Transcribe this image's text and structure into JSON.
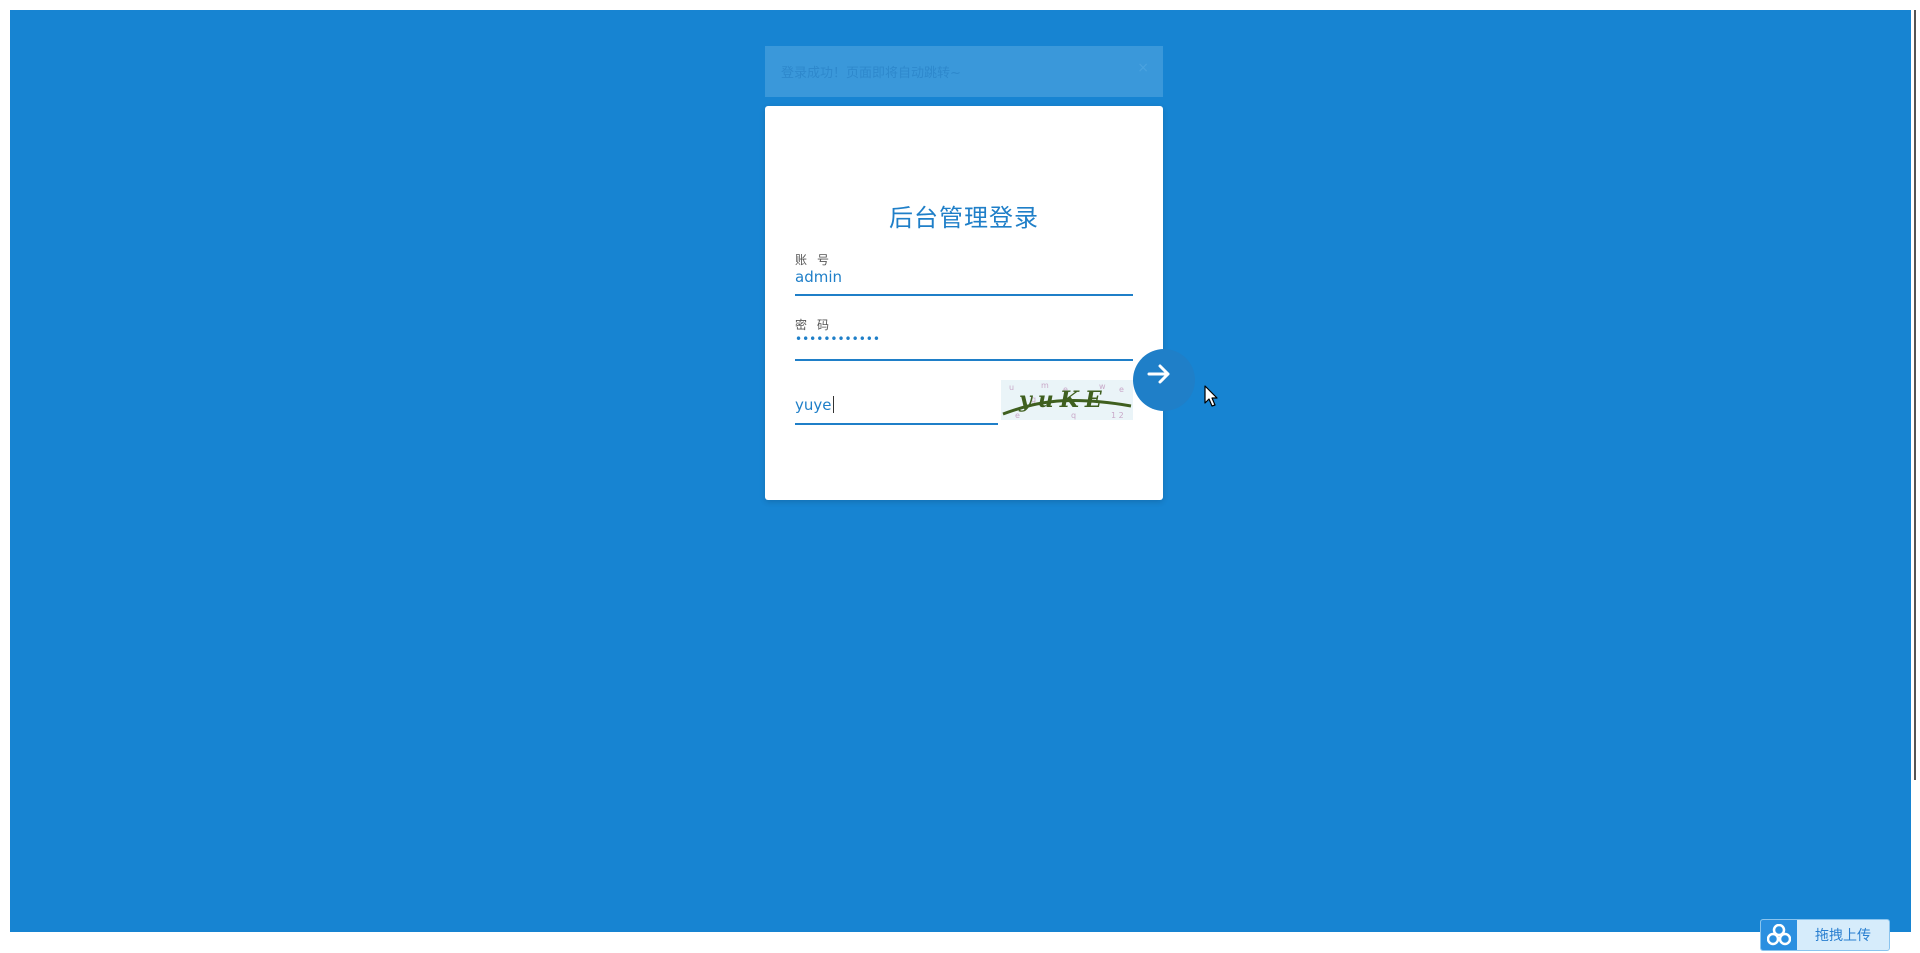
{
  "toast": {
    "message": "登录成功！页面即将自动跳转~",
    "close": "×"
  },
  "login": {
    "title": "后台管理登录",
    "account_label": "账号",
    "account_value": "admin",
    "password_label": "密码",
    "password_value": "••••••••••••",
    "captcha_value": "yuye",
    "captcha_image_text": "yuKE"
  },
  "upload": {
    "label": "拖拽上传"
  },
  "colors": {
    "background": "#1784d2",
    "accent": "#1f7fc8"
  }
}
